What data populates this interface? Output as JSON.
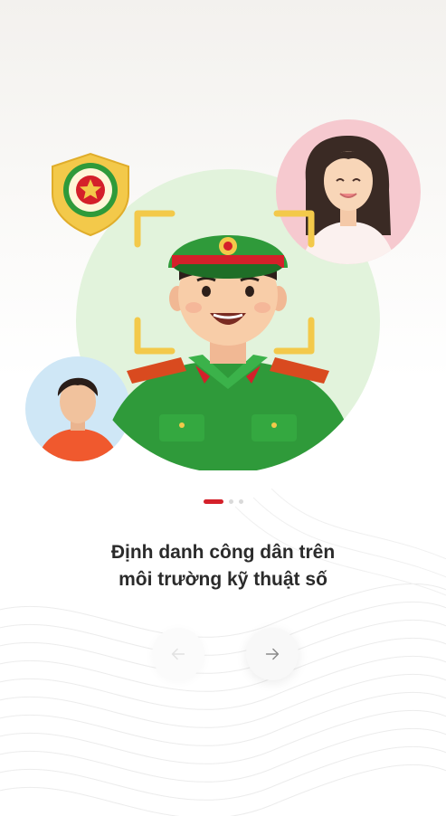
{
  "onboarding": {
    "title_line1": "Định danh công dân trên",
    "title_line2": "môi trường kỹ thuật số",
    "page_indicator": {
      "total": 3,
      "current": 1
    },
    "buttons": {
      "prev_icon": "arrow-left-icon",
      "next_icon": "arrow-right-icon"
    }
  },
  "colors": {
    "accent": "#d4202a",
    "uniform_green": "#2f9a3a",
    "face_frame": "#f3c94a",
    "circle_bg": "#e2f3dc",
    "female_bg": "#f6c9cf",
    "male_bg": "#cfe7f6"
  },
  "icons": [
    "police-shield-badge-icon",
    "face-scan-frame-icon",
    "officer-avatar",
    "woman-avatar",
    "man-avatar"
  ]
}
